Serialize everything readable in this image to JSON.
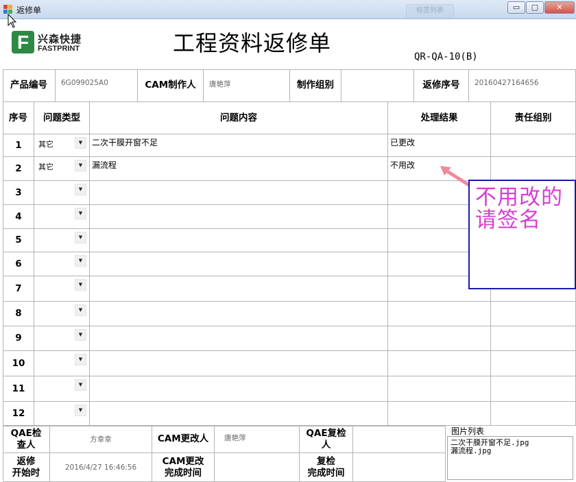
{
  "window": {
    "title": "返修单",
    "controls": {
      "minimize": "▭",
      "maximize": "□",
      "close": "✕"
    },
    "ghost_button": "标签列表"
  },
  "header": {
    "logo_cn": "兴森快捷",
    "logo_en": "FASTPRINT",
    "logo_mark": "F",
    "title": "工程资料返修单",
    "code": "QR-QA-10(B)"
  },
  "info": {
    "product_no_label": "产品编号",
    "product_no": "6G099025A0",
    "cam_maker_label": "CAM制作人",
    "cam_maker": "唐艳萍",
    "make_group_label": "制作组别",
    "make_group": "",
    "repair_seq_label": "返修序号",
    "repair_seq": "20160427164656"
  },
  "table": {
    "headers": {
      "no": "序号",
      "type": "问题类型",
      "content": "问题内容",
      "result": "处理结果",
      "group": "责任组别"
    },
    "dropdown_arrow": "▼",
    "rows": [
      {
        "no": "1",
        "type": "其它",
        "content": "二次干膜开窗不足",
        "result": "已更改",
        "group": ""
      },
      {
        "no": "2",
        "type": "其它",
        "content": "漏流程",
        "result": "不用改",
        "group": ""
      },
      {
        "no": "3",
        "type": "",
        "content": "",
        "result": "",
        "group": ""
      },
      {
        "no": "4",
        "type": "",
        "content": "",
        "result": "",
        "group": ""
      },
      {
        "no": "5",
        "type": "",
        "content": "",
        "result": "",
        "group": ""
      },
      {
        "no": "6",
        "type": "",
        "content": "",
        "result": "",
        "group": ""
      },
      {
        "no": "7",
        "type": "",
        "content": "",
        "result": "",
        "group": ""
      },
      {
        "no": "8",
        "type": "",
        "content": "",
        "result": "",
        "group": ""
      },
      {
        "no": "9",
        "type": "",
        "content": "",
        "result": "",
        "group": ""
      },
      {
        "no": "10",
        "type": "",
        "content": "",
        "result": "",
        "group": ""
      },
      {
        "no": "11",
        "type": "",
        "content": "",
        "result": "",
        "group": ""
      },
      {
        "no": "12",
        "type": "",
        "content": "",
        "result": "",
        "group": ""
      }
    ]
  },
  "annotation": {
    "line1": "不用改的",
    "line2": "请签名",
    "box_color": "#1a1aa8",
    "text_color": "#d63fd0",
    "arrow_color": "#f08a9a"
  },
  "footer": {
    "qae_inspector_label_1": "QAE检",
    "qae_inspector_label_2": "查人",
    "qae_inspector": "方幸幸",
    "cam_modifier_label": "CAM更改人",
    "cam_modifier": "唐艳萍",
    "qae_recheck_label_1": "QAE复检",
    "qae_recheck_label_2": "人",
    "qae_recheck": "",
    "repair_start_label_1": "返修",
    "repair_start_label_2": "开始时",
    "repair_start": "2016/4/27 16:46:56",
    "cam_finish_label_1": "CAM更改",
    "cam_finish_label_2": "完成时间",
    "cam_finish": "",
    "recheck_finish_label_1": "复检",
    "recheck_finish_label_2": "完成时间",
    "recheck_finish": "",
    "image_list_label": "图片列表",
    "images": [
      "二次干膜开窗不足.jpg",
      "漏流程.jpg"
    ]
  },
  "colors": {
    "logo_green": "#2d8a45",
    "grid": "#b3b3b3"
  }
}
